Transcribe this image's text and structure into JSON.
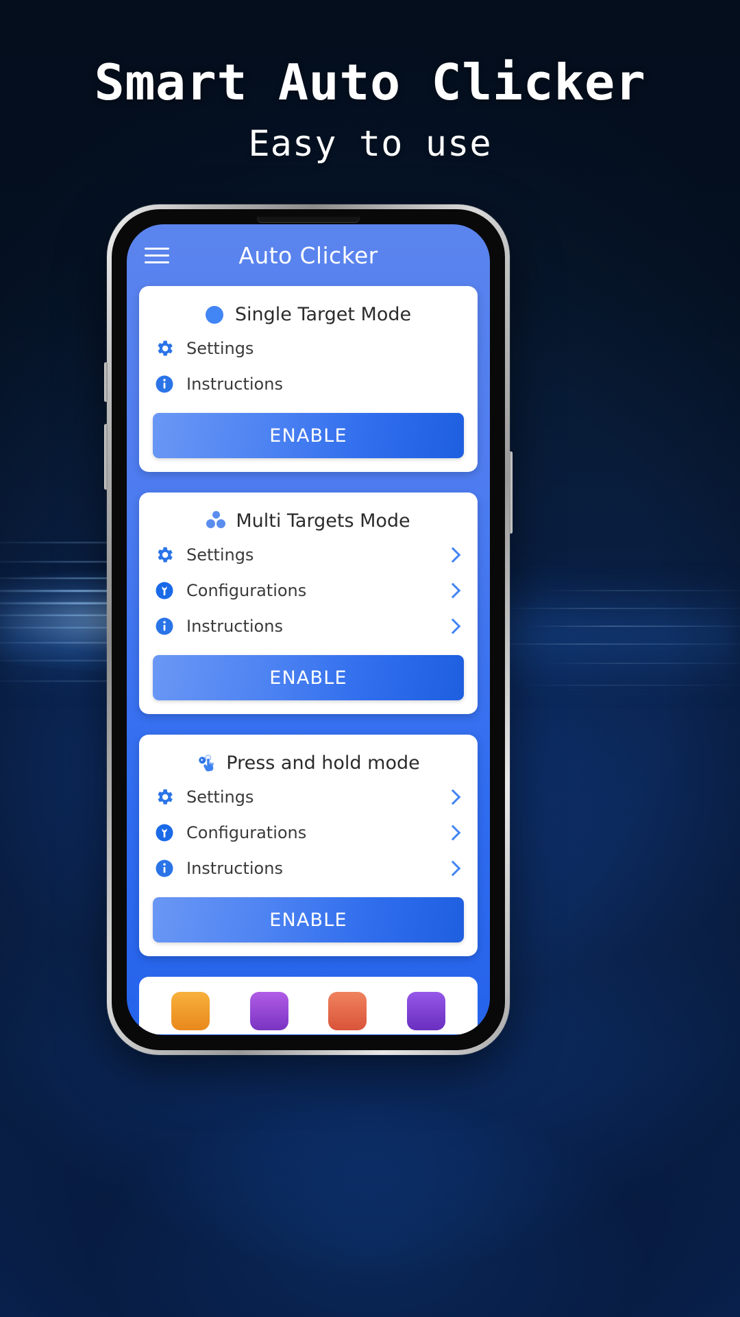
{
  "promo": {
    "title": "Smart Auto Clicker",
    "subtitle": "Easy to use"
  },
  "colors": {
    "accent": "#4285f4",
    "app_header_blue": "#5b84ee",
    "button_gradient_start": "#6a97f5",
    "button_gradient_end": "#1e5fe0",
    "background_dark": "#07182e"
  },
  "app": {
    "header": {
      "menu_icon": "hamburger-menu-icon",
      "title": "Auto Clicker"
    },
    "cards": [
      {
        "icon": "single-target-dot-icon",
        "title": "Single Target Mode",
        "rows": [
          {
            "icon": "gear-icon",
            "label": "Settings",
            "chevron": false
          },
          {
            "icon": "info-icon",
            "label": "Instructions",
            "chevron": false
          }
        ],
        "button": "ENABLE"
      },
      {
        "icon": "multi-targets-dots-icon",
        "title": "Multi Targets Mode",
        "rows": [
          {
            "icon": "gear-icon",
            "label": "Settings",
            "chevron": true
          },
          {
            "icon": "wrench-icon",
            "label": "Configurations",
            "chevron": true
          },
          {
            "icon": "info-icon",
            "label": "Instructions",
            "chevron": true
          }
        ],
        "button": "ENABLE"
      },
      {
        "icon": "press-and-hold-finger-icon",
        "title": "Press and hold mode",
        "rows": [
          {
            "icon": "gear-icon",
            "label": "Settings",
            "chevron": true
          },
          {
            "icon": "wrench-icon",
            "label": "Configurations",
            "chevron": true
          },
          {
            "icon": "info-icon",
            "label": "Instructions",
            "chevron": true
          }
        ],
        "button": "ENABLE"
      }
    ],
    "bottom_bar": {
      "items": [
        {
          "icon": "shirt-app-icon",
          "color": "#f3a21c"
        },
        {
          "icon": "tools-app-icon",
          "color": "#9b4fd6"
        },
        {
          "icon": "clipboard-app-icon",
          "color": "#e86a4a"
        },
        {
          "icon": "chat-app-icon",
          "color": "#7b3fd1"
        }
      ]
    }
  }
}
